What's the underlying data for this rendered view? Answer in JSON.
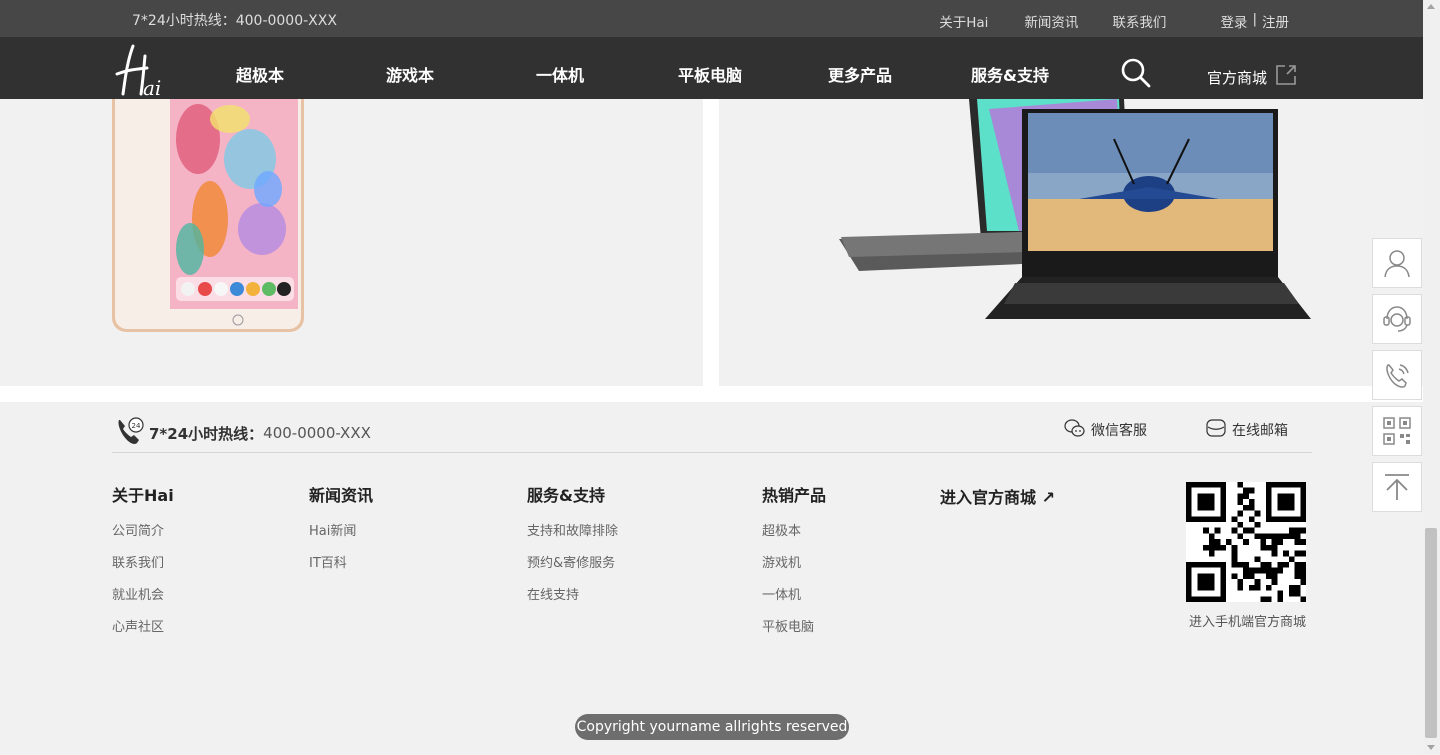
{
  "topbar": {
    "hotline": "7*24小时热线：400-0000-XXX",
    "links": [
      "关于Hai",
      "新闻资讯",
      "联系我们"
    ],
    "login": "登录",
    "separator": "|",
    "register": "注册"
  },
  "nav": {
    "logo_text": "Hai",
    "items": [
      "超极本",
      "游戏本",
      "一体机",
      "平板电脑",
      "更多产品",
      "服务&支持"
    ],
    "mall": "官方商城"
  },
  "footer": {
    "hotline_label": "7*24小时热线：",
    "hotline_number": "400-0000-XXX",
    "wechat": "微信客服",
    "email": "在线邮箱",
    "columns": [
      {
        "title": "关于Hai",
        "links": [
          "公司简介",
          "联系我们",
          "就业机会",
          "心声社区"
        ]
      },
      {
        "title": "新闻资讯",
        "links": [
          "Hai新闻",
          "IT百科"
        ]
      },
      {
        "title": "服务&支持",
        "links": [
          "支持和故障排除",
          "预约&寄修服务",
          "在线支持"
        ]
      },
      {
        "title": "热销产品",
        "links": [
          "超极本",
          "游戏机",
          "一体机",
          "平板电脑"
        ]
      }
    ],
    "mall_link": "进入官方商城 ↗",
    "qr_caption": "进入手机端官方商城",
    "copyright": "Copyright yourname allrights reserved"
  },
  "floatbar": [
    "user-icon",
    "customer-service-icon",
    "phone-icon",
    "qrcode-icon",
    "back-to-top-icon"
  ],
  "colors": {
    "topbar": "#474747",
    "navbar": "#313131",
    "background": "#f1f1f1"
  }
}
